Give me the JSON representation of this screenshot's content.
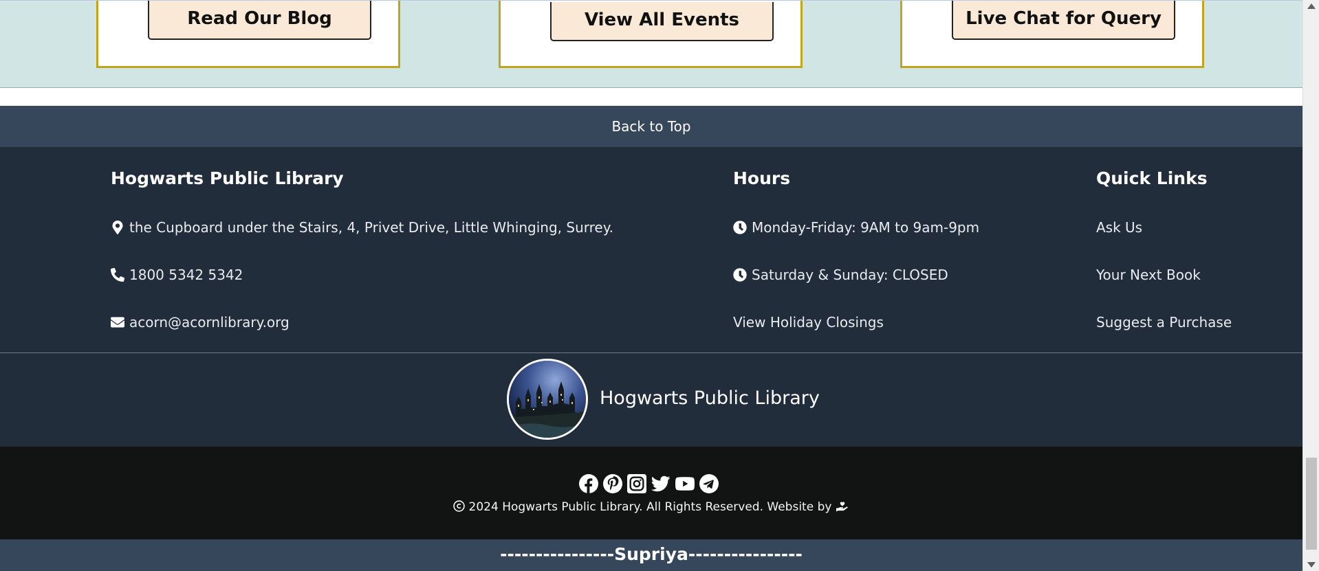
{
  "cards": [
    {
      "button": "Read Our Blog"
    },
    {
      "button": "View All Events"
    },
    {
      "button": "Live Chat for Query"
    }
  ],
  "back_to_top": "Back to Top",
  "footer": {
    "library": {
      "title": "Hogwarts Public Library",
      "address": "the Cupboard under the Stairs, 4, Privet Drive, Little Whinging, Surrey.",
      "phone": "1800 5342 5342",
      "email": "acorn@acornlibrary.org"
    },
    "hours": {
      "title": "Hours",
      "weekdays": "Monday-Friday: 9AM to 9am-9pm",
      "weekend": "Saturday & Sunday: CLOSED",
      "holiday_link": "View Holiday Closings"
    },
    "quick_links": {
      "title": "Quick Links",
      "items": [
        "Ask Us",
        "Your Next Book",
        "Suggest a Purchase"
      ]
    }
  },
  "brand": {
    "name": "Hogwarts Public Library"
  },
  "social": {
    "icons": [
      "facebook-icon",
      "pinterest-icon",
      "instagram-icon",
      "twitter-icon",
      "youtube-icon",
      "telegram-icon"
    ],
    "copyright": "2024 Hogwarts Public Library. All Rights Reserved. Website by"
  },
  "signature": "----------------Supriya----------------"
}
